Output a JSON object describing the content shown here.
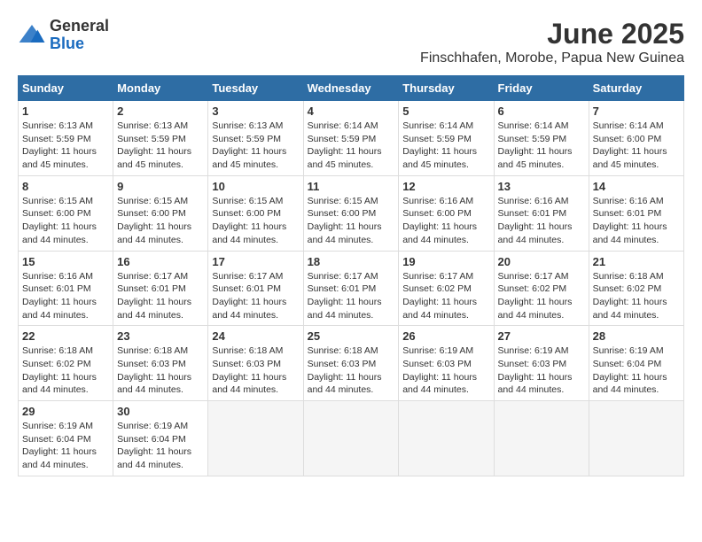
{
  "logo": {
    "general": "General",
    "blue": "Blue"
  },
  "title": "June 2025",
  "subtitle": "Finschhafen, Morobe, Papua New Guinea",
  "header": {
    "days": [
      "Sunday",
      "Monday",
      "Tuesday",
      "Wednesday",
      "Thursday",
      "Friday",
      "Saturday"
    ]
  },
  "weeks": [
    [
      {
        "day": "1",
        "sunrise": "6:13 AM",
        "sunset": "5:59 PM",
        "daylight": "11 hours and 45 minutes."
      },
      {
        "day": "2",
        "sunrise": "6:13 AM",
        "sunset": "5:59 PM",
        "daylight": "11 hours and 45 minutes."
      },
      {
        "day": "3",
        "sunrise": "6:13 AM",
        "sunset": "5:59 PM",
        "daylight": "11 hours and 45 minutes."
      },
      {
        "day": "4",
        "sunrise": "6:14 AM",
        "sunset": "5:59 PM",
        "daylight": "11 hours and 45 minutes."
      },
      {
        "day": "5",
        "sunrise": "6:14 AM",
        "sunset": "5:59 PM",
        "daylight": "11 hours and 45 minutes."
      },
      {
        "day": "6",
        "sunrise": "6:14 AM",
        "sunset": "5:59 PM",
        "daylight": "11 hours and 45 minutes."
      },
      {
        "day": "7",
        "sunrise": "6:14 AM",
        "sunset": "6:00 PM",
        "daylight": "11 hours and 45 minutes."
      }
    ],
    [
      {
        "day": "8",
        "sunrise": "6:15 AM",
        "sunset": "6:00 PM",
        "daylight": "11 hours and 44 minutes."
      },
      {
        "day": "9",
        "sunrise": "6:15 AM",
        "sunset": "6:00 PM",
        "daylight": "11 hours and 44 minutes."
      },
      {
        "day": "10",
        "sunrise": "6:15 AM",
        "sunset": "6:00 PM",
        "daylight": "11 hours and 44 minutes."
      },
      {
        "day": "11",
        "sunrise": "6:15 AM",
        "sunset": "6:00 PM",
        "daylight": "11 hours and 44 minutes."
      },
      {
        "day": "12",
        "sunrise": "6:16 AM",
        "sunset": "6:00 PM",
        "daylight": "11 hours and 44 minutes."
      },
      {
        "day": "13",
        "sunrise": "6:16 AM",
        "sunset": "6:01 PM",
        "daylight": "11 hours and 44 minutes."
      },
      {
        "day": "14",
        "sunrise": "6:16 AM",
        "sunset": "6:01 PM",
        "daylight": "11 hours and 44 minutes."
      }
    ],
    [
      {
        "day": "15",
        "sunrise": "6:16 AM",
        "sunset": "6:01 PM",
        "daylight": "11 hours and 44 minutes."
      },
      {
        "day": "16",
        "sunrise": "6:17 AM",
        "sunset": "6:01 PM",
        "daylight": "11 hours and 44 minutes."
      },
      {
        "day": "17",
        "sunrise": "6:17 AM",
        "sunset": "6:01 PM",
        "daylight": "11 hours and 44 minutes."
      },
      {
        "day": "18",
        "sunrise": "6:17 AM",
        "sunset": "6:01 PM",
        "daylight": "11 hours and 44 minutes."
      },
      {
        "day": "19",
        "sunrise": "6:17 AM",
        "sunset": "6:02 PM",
        "daylight": "11 hours and 44 minutes."
      },
      {
        "day": "20",
        "sunrise": "6:17 AM",
        "sunset": "6:02 PM",
        "daylight": "11 hours and 44 minutes."
      },
      {
        "day": "21",
        "sunrise": "6:18 AM",
        "sunset": "6:02 PM",
        "daylight": "11 hours and 44 minutes."
      }
    ],
    [
      {
        "day": "22",
        "sunrise": "6:18 AM",
        "sunset": "6:02 PM",
        "daylight": "11 hours and 44 minutes."
      },
      {
        "day": "23",
        "sunrise": "6:18 AM",
        "sunset": "6:03 PM",
        "daylight": "11 hours and 44 minutes."
      },
      {
        "day": "24",
        "sunrise": "6:18 AM",
        "sunset": "6:03 PM",
        "daylight": "11 hours and 44 minutes."
      },
      {
        "day": "25",
        "sunrise": "6:18 AM",
        "sunset": "6:03 PM",
        "daylight": "11 hours and 44 minutes."
      },
      {
        "day": "26",
        "sunrise": "6:19 AM",
        "sunset": "6:03 PM",
        "daylight": "11 hours and 44 minutes."
      },
      {
        "day": "27",
        "sunrise": "6:19 AM",
        "sunset": "6:03 PM",
        "daylight": "11 hours and 44 minutes."
      },
      {
        "day": "28",
        "sunrise": "6:19 AM",
        "sunset": "6:04 PM",
        "daylight": "11 hours and 44 minutes."
      }
    ],
    [
      {
        "day": "29",
        "sunrise": "6:19 AM",
        "sunset": "6:04 PM",
        "daylight": "11 hours and 44 minutes."
      },
      {
        "day": "30",
        "sunrise": "6:19 AM",
        "sunset": "6:04 PM",
        "daylight": "11 hours and 44 minutes."
      },
      null,
      null,
      null,
      null,
      null
    ]
  ]
}
